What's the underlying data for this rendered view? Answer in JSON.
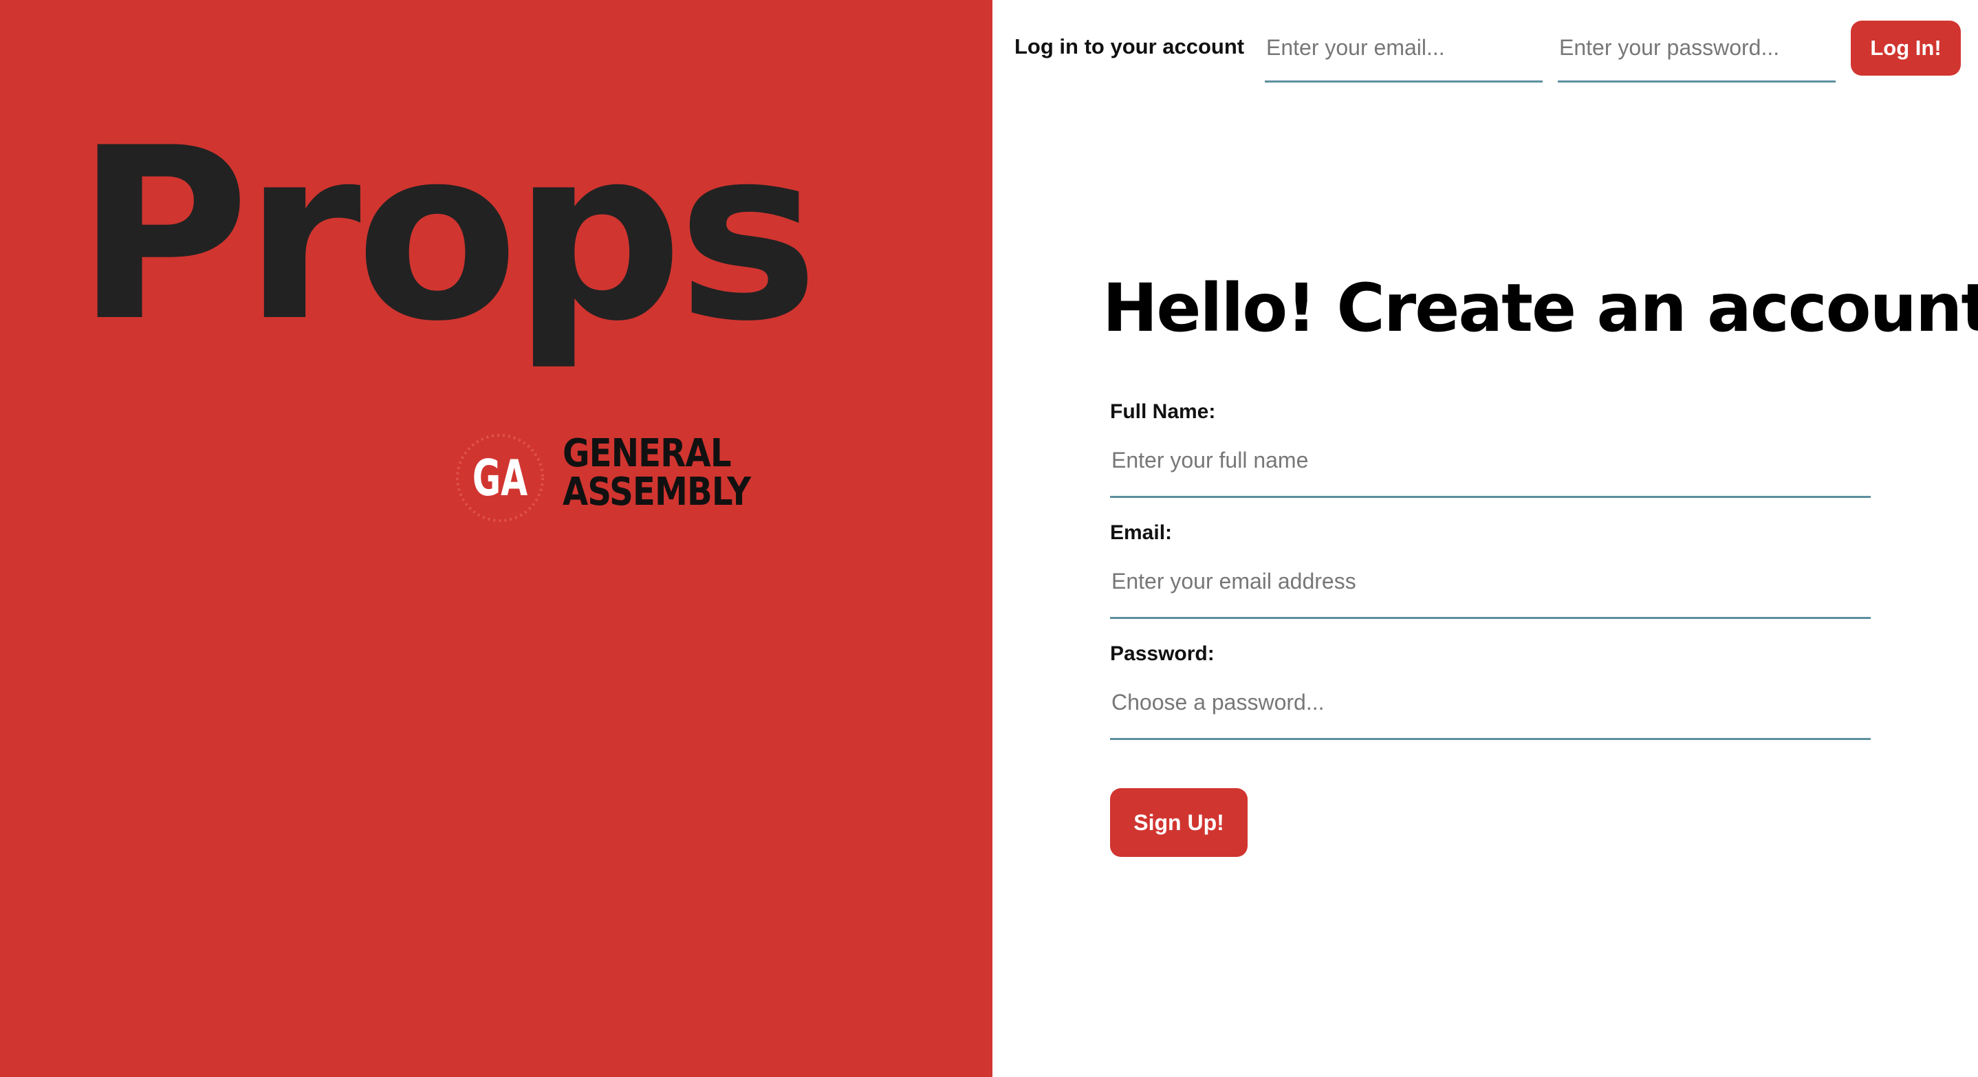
{
  "brand": {
    "title": "Props",
    "partner_logo": {
      "mark": "GA",
      "line1": "GENERAL",
      "line2": "ASSEMBLY"
    }
  },
  "login": {
    "label": "Log in to your account",
    "email_placeholder": "Enter your email...",
    "password_placeholder": "Enter your password...",
    "button_label": "Log In!"
  },
  "signup": {
    "heading": "Hello! Create an account!",
    "fields": [
      {
        "label": "Full Name:",
        "placeholder": "Enter your full name"
      },
      {
        "label": "Email:",
        "placeholder": "Enter your email address"
      },
      {
        "label": "Password:",
        "placeholder": "Choose a password..."
      }
    ],
    "button_label": "Sign Up!"
  },
  "colors": {
    "accent": "#d13530",
    "title_text": "#222222",
    "input_underline": "#5c8f9e"
  },
  "icons": {
    "partner_logo": "general-assembly-logo"
  }
}
